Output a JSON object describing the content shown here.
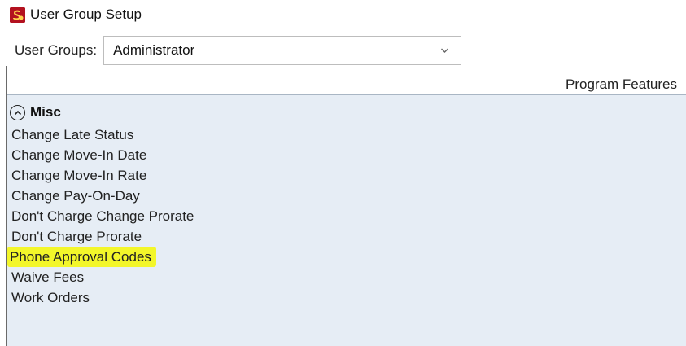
{
  "window": {
    "title": "User Group Setup",
    "icon": "app-logo-icon"
  },
  "user_groups": {
    "label": "User Groups:",
    "selected": "Administrator"
  },
  "program_features": {
    "header": "Program Features"
  },
  "group": {
    "title": "Misc",
    "collapse_icon": "chevron-up-circle-icon",
    "items": [
      {
        "label": "Change Late Status",
        "highlighted": false
      },
      {
        "label": "Change Move-In Date",
        "highlighted": false
      },
      {
        "label": "Change Move-In Rate",
        "highlighted": false
      },
      {
        "label": "Change Pay-On-Day",
        "highlighted": false
      },
      {
        "label": "Don't Charge Change Prorate",
        "highlighted": false
      },
      {
        "label": "Don't Charge Prorate",
        "highlighted": false
      },
      {
        "label": "Phone Approval Codes",
        "highlighted": true
      },
      {
        "label": "Waive Fees",
        "highlighted": false
      },
      {
        "label": "Work Orders",
        "highlighted": false
      }
    ]
  },
  "colors": {
    "panel_background": "#e6edf5",
    "highlight": "#f3f62a",
    "icon_red": "#b3121f",
    "banner_red": "#ff0000"
  }
}
